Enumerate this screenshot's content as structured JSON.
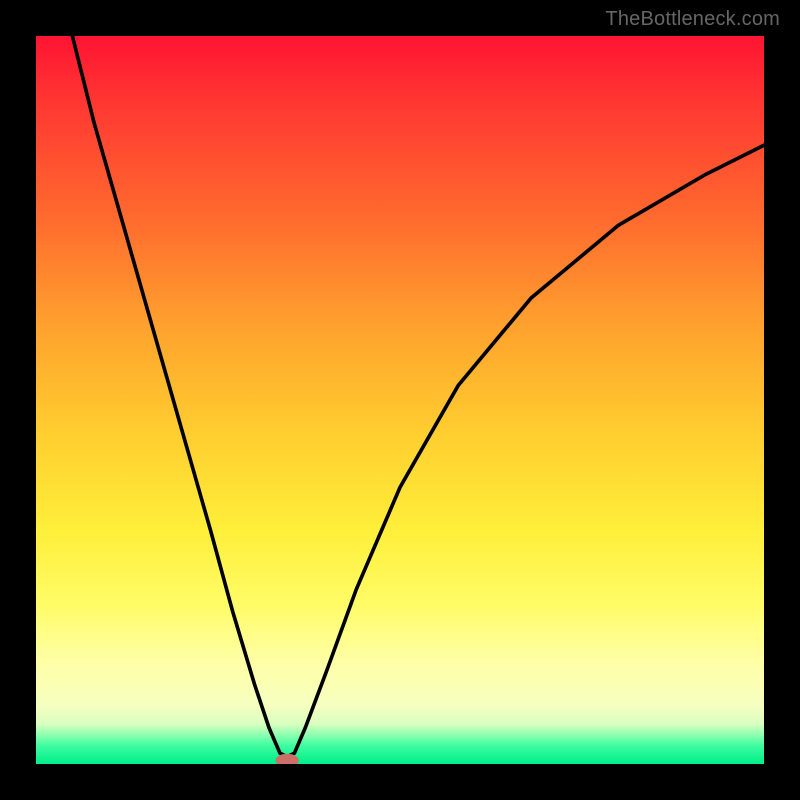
{
  "attribution": "TheBottleneck.com",
  "chart_data": {
    "type": "line",
    "title": "",
    "xlabel": "",
    "ylabel": "",
    "xlim": [
      0,
      100
    ],
    "ylim": [
      0,
      100
    ],
    "background_gradient": {
      "type": "vertical",
      "stops": [
        {
          "pos": 0,
          "color": "#ff1433"
        },
        {
          "pos": 0.55,
          "color": "#ffcf2f"
        },
        {
          "pos": 0.92,
          "color": "#f6ffc0"
        },
        {
          "pos": 1.0,
          "color": "#00ef8a"
        }
      ]
    },
    "series": [
      {
        "name": "bottleneck-curve",
        "color": "#000000",
        "x": [
          5,
          8,
          12,
          16,
          20,
          24,
          27,
          30,
          32,
          33.5,
          34.5,
          35.5,
          37,
          40,
          44,
          50,
          58,
          68,
          80,
          92,
          100
        ],
        "y": [
          100,
          88,
          74,
          60,
          46,
          32,
          21,
          11,
          5,
          1.5,
          1,
          1.5,
          5,
          13,
          24,
          38,
          52,
          64,
          74,
          81,
          85
        ]
      }
    ],
    "marker": {
      "name": "bottleneck-optimal-marker",
      "x": 34.5,
      "y": 0.5,
      "color": "#cc6f66",
      "shape": "pill"
    }
  }
}
